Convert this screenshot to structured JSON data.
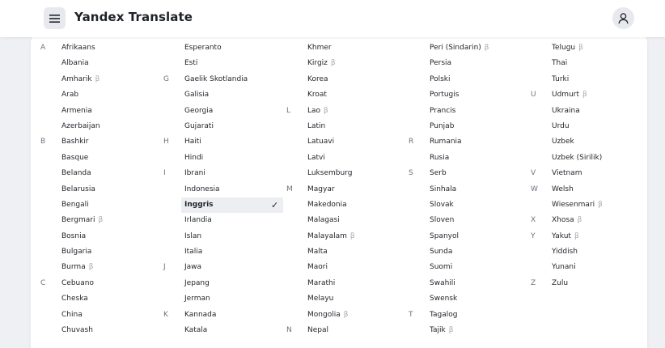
{
  "header": {
    "title": "Yandex Translate",
    "menu_icon": "hamburger-menu-icon",
    "user_icon": "user-icon"
  },
  "beta_symbol": "β",
  "check_symbol": "✓",
  "columns": [
    [
      {
        "letter": "A",
        "name": "Afrikaans"
      },
      {
        "name": "Albania"
      },
      {
        "name": "Amharik",
        "beta": true
      },
      {
        "name": "Arab"
      },
      {
        "name": "Armenia"
      },
      {
        "name": "Azerbaijan"
      },
      {
        "letter": "B",
        "name": "Bashkir"
      },
      {
        "name": "Basque"
      },
      {
        "name": "Belanda"
      },
      {
        "name": "Belarusia"
      },
      {
        "name": "Bengali"
      },
      {
        "name": "Bergmari",
        "beta": true
      },
      {
        "name": "Bosnia"
      },
      {
        "name": "Bulgaria"
      },
      {
        "name": "Burma",
        "beta": true
      },
      {
        "letter": "C",
        "name": "Cebuano"
      },
      {
        "name": "Cheska"
      },
      {
        "name": "China"
      },
      {
        "name": "Chuvash"
      }
    ],
    [
      {
        "name": "Esperanto"
      },
      {
        "name": "Esti"
      },
      {
        "letter": "G",
        "name": "Gaelik Skotlandia"
      },
      {
        "name": "Galisia"
      },
      {
        "name": "Georgia"
      },
      {
        "name": "Gujarati"
      },
      {
        "letter": "H",
        "name": "Haiti"
      },
      {
        "name": "Hindi"
      },
      {
        "letter": "I",
        "name": "Ibrani"
      },
      {
        "name": "Indonesia"
      },
      {
        "name": "Inggris",
        "selected": true
      },
      {
        "name": "Irlandia"
      },
      {
        "name": "Islan"
      },
      {
        "name": "Italia"
      },
      {
        "letter": "J",
        "name": "Jawa"
      },
      {
        "name": "Jepang"
      },
      {
        "name": "Jerman"
      },
      {
        "letter": "K",
        "name": "Kannada"
      },
      {
        "name": "Katala"
      }
    ],
    [
      {
        "name": "Khmer"
      },
      {
        "name": "Kirgiz",
        "beta": true
      },
      {
        "name": "Korea"
      },
      {
        "name": "Kroat"
      },
      {
        "letter": "L",
        "name": "Lao",
        "beta": true
      },
      {
        "name": "Latin"
      },
      {
        "name": "Latuavi"
      },
      {
        "name": "Latvi"
      },
      {
        "name": "Luksemburg"
      },
      {
        "letter": "M",
        "name": "Magyar"
      },
      {
        "name": "Makedonia"
      },
      {
        "name": "Malagasi"
      },
      {
        "name": "Malayalam",
        "beta": true
      },
      {
        "name": "Malta"
      },
      {
        "name": "Maori"
      },
      {
        "name": "Marathi"
      },
      {
        "name": "Melayu"
      },
      {
        "name": "Mongolia",
        "beta": true
      },
      {
        "letter": "N",
        "name": "Nepal"
      }
    ],
    [
      {
        "name": "Peri (Sindarin)",
        "beta": true
      },
      {
        "name": "Persia"
      },
      {
        "name": "Polski"
      },
      {
        "name": "Portugis"
      },
      {
        "name": "Prancis"
      },
      {
        "name": "Punjab"
      },
      {
        "letter": "R",
        "name": "Rumania"
      },
      {
        "name": "Rusia"
      },
      {
        "letter": "S",
        "name": "Serb"
      },
      {
        "name": "Sinhala"
      },
      {
        "name": "Slovak"
      },
      {
        "name": "Sloven"
      },
      {
        "name": "Spanyol"
      },
      {
        "name": "Sunda"
      },
      {
        "name": "Suomi"
      },
      {
        "name": "Swahili"
      },
      {
        "name": "Swensk"
      },
      {
        "letter": "T",
        "name": "Tagalog"
      },
      {
        "name": "Tajik",
        "beta": true
      }
    ],
    [
      {
        "name": "Telugu",
        "beta": true
      },
      {
        "name": "Thai"
      },
      {
        "name": "Turki"
      },
      {
        "letter": "U",
        "name": "Udmurt",
        "beta": true
      },
      {
        "name": "Ukraina"
      },
      {
        "name": "Urdu"
      },
      {
        "name": "Uzbek"
      },
      {
        "name": "Uzbek (Sirilik)"
      },
      {
        "letter": "V",
        "name": "Vietnam"
      },
      {
        "letter": "W",
        "name": "Welsh"
      },
      {
        "name": "Wiesenmari",
        "beta": true
      },
      {
        "letter": "X",
        "name": "Xhosa",
        "beta": true
      },
      {
        "letter": "Y",
        "name": "Yakut",
        "beta": true
      },
      {
        "name": "Yiddish"
      },
      {
        "name": "Yunani"
      },
      {
        "letter": "Z",
        "name": "Zulu"
      }
    ]
  ]
}
